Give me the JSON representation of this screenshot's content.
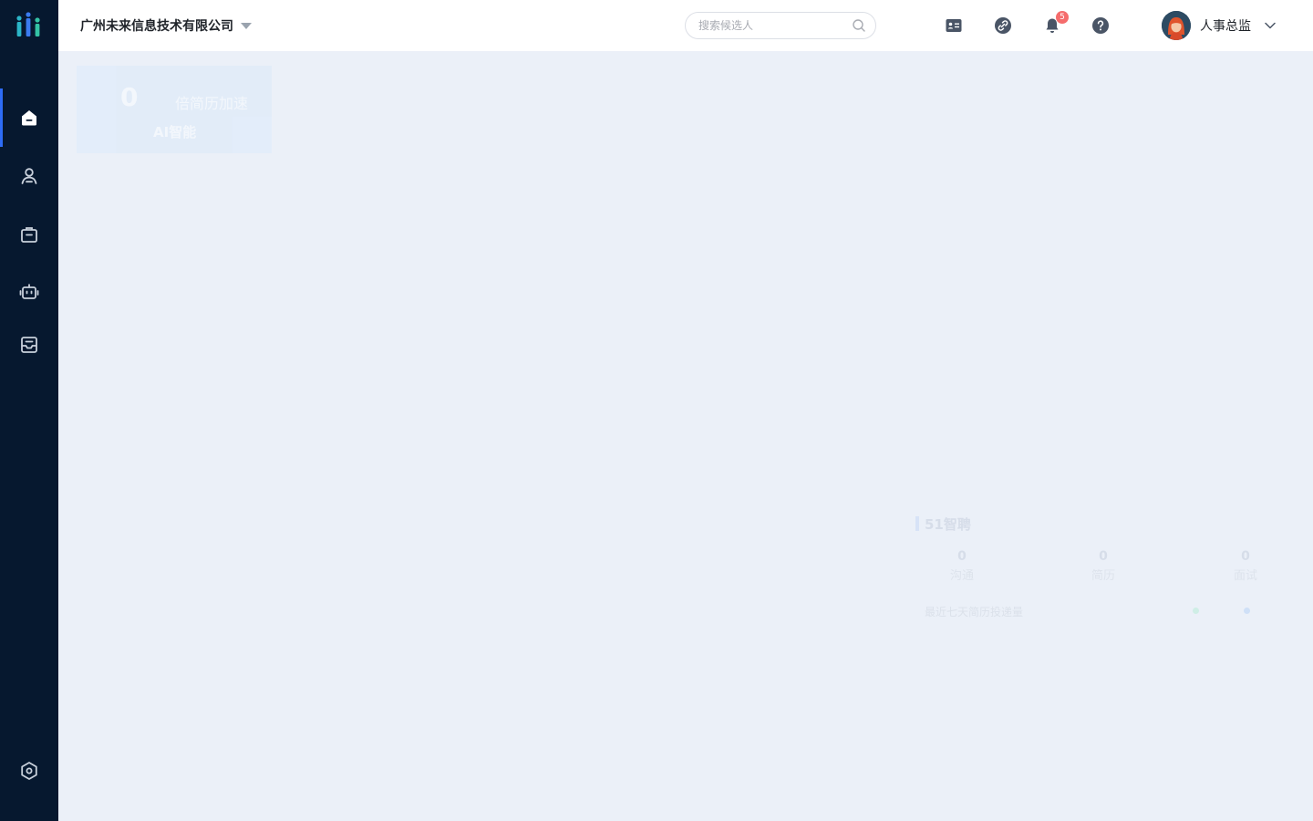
{
  "header": {
    "company": "广州未来信息技术有限公司",
    "search_placeholder": "搜索候选人",
    "notification_count": "5",
    "user_name": "人事总监"
  },
  "sidebar": {
    "items": [
      {
        "icon": "home-icon",
        "active": true
      },
      {
        "icon": "user-icon",
        "active": false
      },
      {
        "icon": "briefcase-icon",
        "active": false
      },
      {
        "icon": "robot-icon",
        "active": false
      },
      {
        "icon": "inbox-icon",
        "active": false
      }
    ],
    "bottom_icon": "settings-icon"
  },
  "ai_card": {
    "count": "0",
    "description": "倍简历加速",
    "label": "AI智能"
  },
  "stat_panel": {
    "title": "51智聘",
    "columns": [
      {
        "value": "0",
        "label": "沟通"
      },
      {
        "value": "0",
        "label": "简历"
      },
      {
        "value": "0",
        "label": "面试"
      }
    ],
    "note": "最近七天简历投递量"
  },
  "colors": {
    "sidebar_bg": "#06182f",
    "accent": "#2e6cf6",
    "badge": "#f56c6c",
    "content_bg": "#ebf0f8"
  }
}
